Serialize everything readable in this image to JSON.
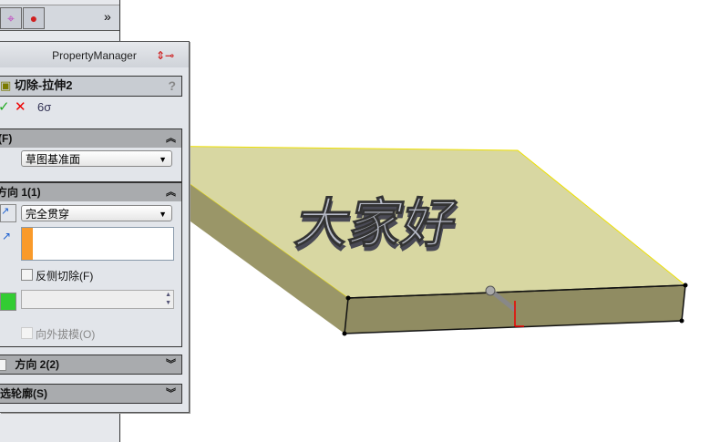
{
  "tree_panel": {
    "tabs": [
      "target-icon",
      "appearance-icon"
    ],
    "expand_label": "»"
  },
  "property_manager": {
    "title": "PropertyManager",
    "feature_name": "切除-拉伸2",
    "help": "?",
    "from_section": {
      "label": "从(F)",
      "value": "草图基准面"
    },
    "direction1": {
      "label": "方向 1(1)",
      "end_condition": "完全贯穿",
      "flip_side_label": "反侧切除(F)",
      "draft_outward_label": "向外拔模(O)"
    },
    "direction2": {
      "label": "方向 2(2)"
    },
    "selected_contours": {
      "label": "所选轮廓(S)"
    }
  },
  "model": {
    "text": "大家好",
    "face_color": "#d6d59a",
    "side_color": "#8f8b63",
    "edge_color": "#f0e800"
  }
}
